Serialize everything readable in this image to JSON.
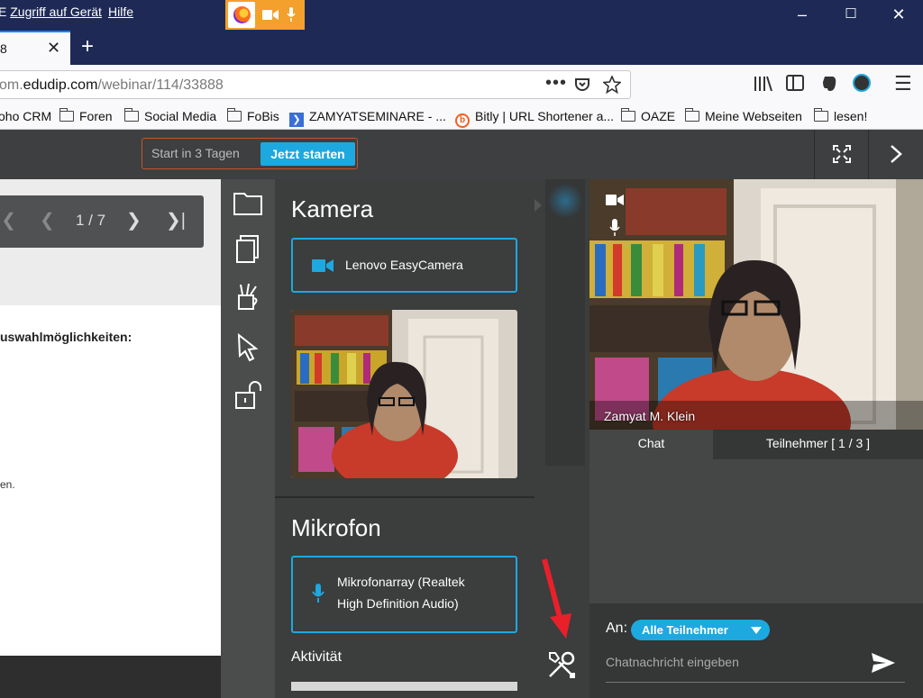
{
  "titlebar": {
    "menu_left": "Zugriff auf Gerät",
    "menu_prefix": "E",
    "menu_help": "Hilfe",
    "controls": {
      "minimize": "–",
      "maximize": "☐",
      "close": "✕"
    }
  },
  "tab": {
    "title": "8",
    "close": "✕",
    "new_tab": "+"
  },
  "urlbar": {
    "prefix": "om.",
    "domain": "edudip.com",
    "path": "/webinar/114/33888"
  },
  "bookmarks": [
    {
      "label": "oho CRM"
    },
    {
      "label": "Foren"
    },
    {
      "label": "Social Media"
    },
    {
      "label": "FoBis"
    },
    {
      "label": "ZAMYATSEMINARE - ..."
    },
    {
      "label": "Bitly | URL Shortener a..."
    },
    {
      "label": "OAZE"
    },
    {
      "label": "Meine Webseiten"
    },
    {
      "label": "lesen!"
    }
  ],
  "apptop": {
    "countdown": "Start in 3 Tagen",
    "start_button": "Jetzt starten"
  },
  "presentation": {
    "page_indicator": "1 / 7",
    "text_bold": "uswahlmöglichkeiten:",
    "text_small": "en."
  },
  "camera": {
    "heading": "Kamera",
    "device": "Lenovo EasyCamera"
  },
  "microphone": {
    "heading": "Mikrofon",
    "device_line1": "Mikrofonarray (Realtek",
    "device_line2": "High Definition Audio)",
    "activity_label": "Aktivität"
  },
  "video": {
    "presenter_name": "Zamyat M. Klein"
  },
  "chat": {
    "tab_chat": "Chat",
    "tab_participants": "Teilnehmer [ 1 / 3 ]",
    "to_label": "An:",
    "recipient": "Alle Teilnehmer",
    "placeholder": "Chatnachricht eingeben"
  },
  "colors": {
    "accent": "#1ea8e0",
    "titlebar": "#1e2a55",
    "permission": "#f3a02d",
    "arrow": "#e8202a"
  }
}
